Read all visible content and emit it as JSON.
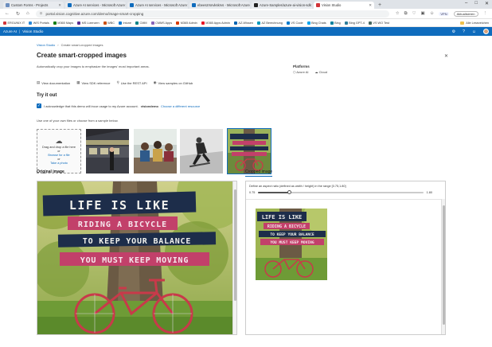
{
  "browser": {
    "tabs": [
      {
        "label": "Custom Forms - Projects",
        "color": "#6c8ebf",
        "active": false
      },
      {
        "label": "Azure AI services - Microsoft Azure",
        "color": "#0f6cbd",
        "active": false
      },
      {
        "label": "Azure AI services - Microsoft Azure",
        "color": "#0f6cbd",
        "active": false
      },
      {
        "label": "ebeeszrsnvkskrvs - Microsoft Azure",
        "color": "#0f6cbd",
        "active": false
      },
      {
        "label": "Azure-Samples/azure-ai-vision-sdk",
        "color": "#222222",
        "active": false
      },
      {
        "label": "Vision Studio",
        "color": "#d13438",
        "active": true
      }
    ],
    "url": "portal.vision.cognitive.azure.com/demo/image-smart-cropping",
    "vpn_label": "VPN",
    "update_label": "Aktualisieren"
  },
  "bookmarks": [
    {
      "label": "ERGUNIX IT",
      "color": "#d13438"
    },
    {
      "label": "WIS Portals",
      "color": "#2b88d8"
    },
    {
      "label": "M365 Maps",
      "color": "#107c10"
    },
    {
      "label": "MS Lizenzen",
      "color": "#5c2d91"
    },
    {
      "label": "WBC",
      "color": "#ca5010"
    },
    {
      "label": "Intune",
      "color": "#0078d4"
    },
    {
      "label": "CMM",
      "color": "#038387"
    },
    {
      "label": "CMMS Apps",
      "color": "#8764b8"
    },
    {
      "label": "M365 Admin",
      "color": "#d83b01"
    },
    {
      "label": "M365 Apps Admin",
      "color": "#e81123"
    },
    {
      "label": "AZ-Wissen",
      "color": "#0063b1"
    },
    {
      "label": "AZ Berechnung",
      "color": "#0099bc"
    },
    {
      "label": "VS Code",
      "color": "#007acc"
    },
    {
      "label": "Bing Chats",
      "color": "#00a4ef"
    },
    {
      "label": "Bing",
      "color": "#00809d"
    },
    {
      "label": "Bing GPT-4",
      "color": "#2d7d9a"
    },
    {
      "label": "VS WO Test",
      "color": "#486860"
    }
  ],
  "bookmarks_other": "Alle Lesezeichen",
  "app": {
    "product": "Azure AI",
    "studio": "Vision Studio"
  },
  "page": {
    "breadcrumb": [
      "Vision Studio",
      "Create smart-cropped images"
    ],
    "title": "Create smart-cropped images",
    "description": "Automatically crop your images to emphasize the images' most important areas.",
    "platform_label": "Platforms",
    "platforms": [
      "Azure AI",
      "Cloud"
    ],
    "links": [
      {
        "label": "View documentation",
        "icon": "document-icon"
      },
      {
        "label": "View SDK reference",
        "icon": "sdk-icon"
      },
      {
        "label": "Use the REST API",
        "icon": "api-icon"
      },
      {
        "label": "View samples on GitHub",
        "icon": "github-icon"
      }
    ],
    "try_title": "Try it out",
    "ack_prefix": "I acknowledge that this demo will incur usage to my Azure account.",
    "ack_resource": "visiondemo",
    "ack_change": "Choose a different resource",
    "hint": "Use one of your own files or choose from a sample below.",
    "upload": {
      "line1": "Drag and drop a file here",
      "line2": "or",
      "line3": "Browse for a file",
      "line4": "or",
      "line5": "Take a photo"
    },
    "original_label": "Original image",
    "cropped_label": "Cropped image",
    "ratio_label": "Define an aspect ratio (defined as width / height) in the range [0.75,1.80]",
    "ratio_min": "0.75",
    "ratio_max": "1.80",
    "ratio_value": 0.95
  },
  "poster_lines": [
    "LIFE IS LIKE",
    "RIDING A BICYCLE",
    "TO KEEP YOUR BALANCE",
    "YOU MUST KEEP MOVING"
  ]
}
